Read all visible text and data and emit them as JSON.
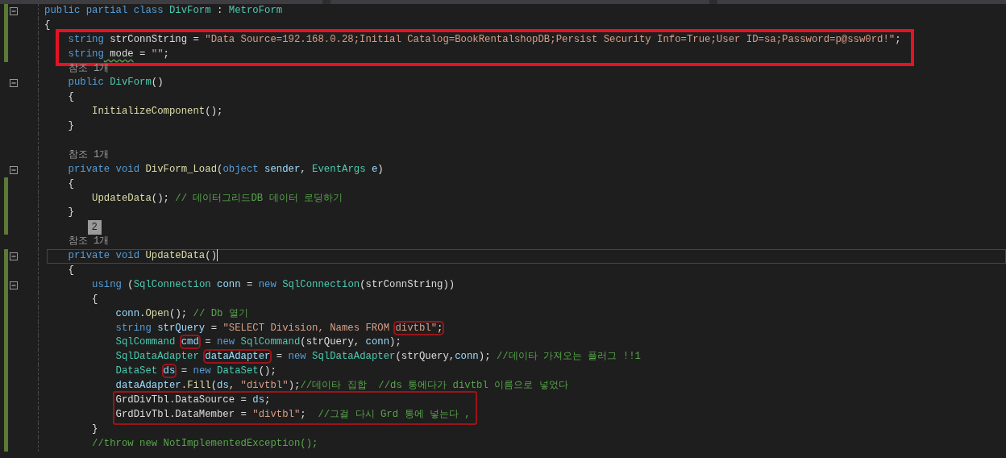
{
  "lines": [
    {
      "kind": "code",
      "modified": true,
      "collapsible": true,
      "tokens": [
        {
          "kind": "keyword",
          "text": "public partial class"
        },
        {
          "kind": "type",
          "text": " DivForm"
        },
        {
          "kind": "plain",
          "text": " : "
        },
        {
          "kind": "type",
          "text": "MetroForm"
        }
      ]
    },
    {
      "kind": "code",
      "modified": true,
      "tokens": [
        {
          "kind": "plain",
          "text": "{"
        }
      ],
      "children": [
        {
          "kind": "code",
          "modified": true,
          "boxed": true,
          "tokens": [
            {
              "kind": "keyword",
              "text": "string"
            },
            {
              "kind": "plain",
              "text": " strConnString = "
            },
            {
              "kind": "string",
              "text": "\"Data Source=192.168.0.28;Initial Catalog=BookRentalshopDB;Persist Security Info=True;User ID=sa;Password=p@ssw0rd!\""
            },
            {
              "kind": "plain",
              "text": ";"
            }
          ]
        },
        {
          "kind": "code",
          "modified": true,
          "boxed": true,
          "tokens": [
            {
              "kind": "keyword",
              "text": "string"
            },
            {
              "kind": "plain",
              "text": " mode",
              "squiggle": true
            },
            {
              "kind": "plain",
              "text": " = "
            },
            {
              "kind": "string",
              "text": "\"\""
            },
            {
              "kind": "plain",
              "text": ";"
            }
          ]
        },
        {
          "kind": "lens",
          "text": "참조 1개"
        },
        {
          "kind": "code",
          "collapsible": true,
          "tokens": [
            {
              "kind": "keyword",
              "text": "public"
            },
            {
              "kind": "type",
              "text": " DivForm"
            },
            {
              "kind": "plain",
              "text": "()"
            }
          ]
        },
        {
          "kind": "code",
          "tokens": [
            {
              "kind": "plain",
              "text": "{"
            }
          ],
          "children": [
            {
              "kind": "code",
              "tokens": [
                {
                  "kind": "method",
                  "text": "InitializeComponent"
                },
                {
                  "kind": "plain",
                  "text": "();"
                }
              ]
            }
          ]
        },
        {
          "kind": "code",
          "tokens": [
            {
              "kind": "plain",
              "text": "}"
            }
          ]
        },
        {
          "kind": "blank"
        },
        {
          "kind": "lens",
          "text": "참조 1개"
        },
        {
          "kind": "code",
          "collapsible": true,
          "tokens": [
            {
              "kind": "keyword",
              "text": "private void"
            },
            {
              "kind": "method",
              "text": " DivForm_Load"
            },
            {
              "kind": "plain",
              "text": "("
            },
            {
              "kind": "keyword",
              "text": "object"
            },
            {
              "kind": "variable",
              "text": " sender"
            },
            {
              "kind": "plain",
              "text": ", "
            },
            {
              "kind": "type",
              "text": "EventArgs"
            },
            {
              "kind": "variable",
              "text": " e"
            },
            {
              "kind": "plain",
              "text": ")"
            }
          ]
        },
        {
          "kind": "code",
          "modified": true,
          "tokens": [
            {
              "kind": "plain",
              "text": "{"
            }
          ],
          "children": [
            {
              "kind": "code",
              "modified": true,
              "tokens": [
                {
                  "kind": "method",
                  "text": "UpdateData"
                },
                {
                  "kind": "plain",
                  "text": "();"
                },
                {
                  "kind": "comment",
                  "text": " // 데이터그리드DB 데이터 로딩하기"
                }
              ]
            }
          ]
        },
        {
          "kind": "code",
          "modified": true,
          "tokens": [
            {
              "kind": "plain",
              "text": "}"
            }
          ]
        },
        {
          "kind": "hint",
          "modified": true,
          "text": "2"
        },
        {
          "kind": "lens",
          "text": "참조 1개"
        },
        {
          "kind": "code",
          "modified": true,
          "collapsible": true,
          "current": true,
          "cursor": true,
          "tokens": [
            {
              "kind": "keyword",
              "text": "private void"
            },
            {
              "kind": "method",
              "text": " UpdateData"
            },
            {
              "kind": "plain",
              "text": "()"
            }
          ]
        },
        {
          "kind": "code",
          "modified": true,
          "tokens": [
            {
              "kind": "plain",
              "text": "{"
            }
          ],
          "children": [
            {
              "kind": "code",
              "modified": true,
              "collapsible": true,
              "tokens": [
                {
                  "kind": "keyword",
                  "text": "using"
                },
                {
                  "kind": "plain",
                  "text": " ("
                },
                {
                  "kind": "type",
                  "text": "SqlConnection"
                },
                {
                  "kind": "variable",
                  "text": " conn"
                },
                {
                  "kind": "plain",
                  "text": " = "
                },
                {
                  "kind": "keyword",
                  "text": "new"
                },
                {
                  "kind": "type",
                  "text": " SqlConnection"
                },
                {
                  "kind": "plain",
                  "text": "(strConnString))"
                }
              ]
            },
            {
              "kind": "code",
              "modified": true,
              "tokens": [
                {
                  "kind": "plain",
                  "text": "{"
                }
              ],
              "children": [
                {
                  "kind": "code",
                  "modified": true,
                  "tokens": [
                    {
                      "kind": "variable",
                      "text": "conn"
                    },
                    {
                      "kind": "plain",
                      "text": "."
                    },
                    {
                      "kind": "method",
                      "text": "Open"
                    },
                    {
                      "kind": "plain",
                      "text": "();"
                    },
                    {
                      "kind": "comment",
                      "text": " // Db 열기"
                    }
                  ]
                },
                {
                  "kind": "code",
                  "modified": true,
                  "tokens": [
                    {
                      "kind": "keyword",
                      "text": "string"
                    },
                    {
                      "kind": "variable",
                      "text": " strQuery"
                    },
                    {
                      "kind": "plain",
                      "text": " = "
                    },
                    {
                      "kind": "string",
                      "text": "\"SELECT Division, Names FROM "
                    },
                    {
                      "kind": "string",
                      "text": "divtbl\"",
                      "circled": true
                    },
                    {
                      "kind": "plain",
                      "text": ";",
                      "circled": true
                    }
                  ]
                },
                {
                  "kind": "code",
                  "modified": true,
                  "tokens": [
                    {
                      "kind": "type",
                      "text": "SqlCommand "
                    },
                    {
                      "kind": "variable",
                      "text": "cmd",
                      "circled": true
                    },
                    {
                      "kind": "plain",
                      "text": " = "
                    },
                    {
                      "kind": "keyword",
                      "text": "new"
                    },
                    {
                      "kind": "type",
                      "text": " SqlCommand"
                    },
                    {
                      "kind": "plain",
                      "text": "(strQuery, "
                    },
                    {
                      "kind": "variable",
                      "text": "conn"
                    },
                    {
                      "kind": "plain",
                      "text": ");"
                    }
                  ]
                },
                {
                  "kind": "code",
                  "modified": true,
                  "tokens": [
                    {
                      "kind": "type",
                      "text": "SqlDataAdapter "
                    },
                    {
                      "kind": "variable",
                      "text": "dataAdapter",
                      "circled": true
                    },
                    {
                      "kind": "plain",
                      "text": " = "
                    },
                    {
                      "kind": "keyword",
                      "text": "new"
                    },
                    {
                      "kind": "type",
                      "text": " SqlDataAdapter"
                    },
                    {
                      "kind": "plain",
                      "text": "(strQuery,"
                    },
                    {
                      "kind": "variable",
                      "text": "conn"
                    },
                    {
                      "kind": "plain",
                      "text": ");"
                    },
                    {
                      "kind": "comment",
                      "text": " //데이타 가져오는 플러그 !!1"
                    }
                  ]
                },
                {
                  "kind": "code",
                  "modified": true,
                  "tokens": [
                    {
                      "kind": "type",
                      "text": "DataSet "
                    },
                    {
                      "kind": "variable",
                      "text": "ds",
                      "circled": true
                    },
                    {
                      "kind": "plain",
                      "text": " = "
                    },
                    {
                      "kind": "keyword",
                      "text": "new"
                    },
                    {
                      "kind": "type",
                      "text": " DataSet"
                    },
                    {
                      "kind": "plain",
                      "text": "();"
                    }
                  ]
                },
                {
                  "kind": "code",
                  "modified": true,
                  "tokens": [
                    {
                      "kind": "variable",
                      "text": "dataAdapter"
                    },
                    {
                      "kind": "plain",
                      "text": "."
                    },
                    {
                      "kind": "method",
                      "text": "Fill"
                    },
                    {
                      "kind": "plain",
                      "text": "("
                    },
                    {
                      "kind": "variable",
                      "text": "ds"
                    },
                    {
                      "kind": "plain",
                      "text": ", "
                    },
                    {
                      "kind": "string",
                      "text": "\"divtbl\""
                    },
                    {
                      "kind": "plain",
                      "text": ");"
                    },
                    {
                      "kind": "comment",
                      "text": "//데이타 집합  //ds 통에다가 divtbl 이름으로 넣었다"
                    }
                  ]
                },
                {
                  "kind": "code",
                  "modified": true,
                  "pen_marked": true,
                  "tokens": [
                    {
                      "kind": "plain",
                      "text": "GrdDivTbl.DataSource = "
                    },
                    {
                      "kind": "variable",
                      "text": "ds"
                    },
                    {
                      "kind": "plain",
                      "text": ";"
                    }
                  ]
                },
                {
                  "kind": "code",
                  "modified": true,
                  "pen_marked": true,
                  "tokens": [
                    {
                      "kind": "plain",
                      "text": "GrdDivTbl.DataMember = "
                    },
                    {
                      "kind": "string",
                      "text": "\"divtbl\""
                    },
                    {
                      "kind": "plain",
                      "text": ";"
                    },
                    {
                      "kind": "comment",
                      "text": "  //그걸 다시 Grd 통에 넣는다 ,"
                    }
                  ]
                }
              ]
            },
            {
              "kind": "code",
              "modified": true,
              "tokens": [
                {
                  "kind": "plain",
                  "text": "}"
                }
              ]
            },
            {
              "kind": "code",
              "modified": true,
              "tokens": [
                {
                  "kind": "comment",
                  "text": "//throw new NotImplementedException();"
                }
              ]
            }
          ]
        }
      ]
    }
  ]
}
